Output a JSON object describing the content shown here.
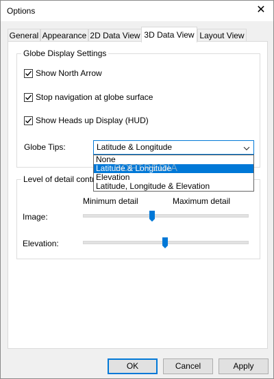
{
  "window": {
    "title": "Options"
  },
  "tabs": [
    {
      "label": "General"
    },
    {
      "label": "Appearance"
    },
    {
      "label": "2D Data View"
    },
    {
      "label": "3D Data View",
      "active": true
    },
    {
      "label": "Layout View"
    }
  ],
  "globe": {
    "group_label": "Globe Display Settings",
    "checkboxes": [
      {
        "label": "Show North Arrow",
        "checked": true
      },
      {
        "label": "Stop navigation at globe surface",
        "checked": true
      },
      {
        "label": "Show Heads up Display (HUD)",
        "checked": true
      }
    ],
    "tips_label": "Globe Tips:",
    "tips_selected": "Latitude & Longitude",
    "tips_options": [
      "None",
      "Latitude & Longitude",
      "Elevation",
      "Latitude, Longitude & Elevation"
    ]
  },
  "detail": {
    "group_label": "Level of detail controls",
    "min_label": "Minimum detail",
    "max_label": "Maximum detail",
    "image_label": "Image:",
    "image_level": 0.42,
    "elevation_label": "Elevation:",
    "elevation_level": 0.5
  },
  "buttons": {
    "ok": "OK",
    "cancel": "Cancel",
    "apply": "Apply"
  },
  "watermark": "SOFTPEDIA",
  "colors": {
    "accent": "#0078d7"
  }
}
